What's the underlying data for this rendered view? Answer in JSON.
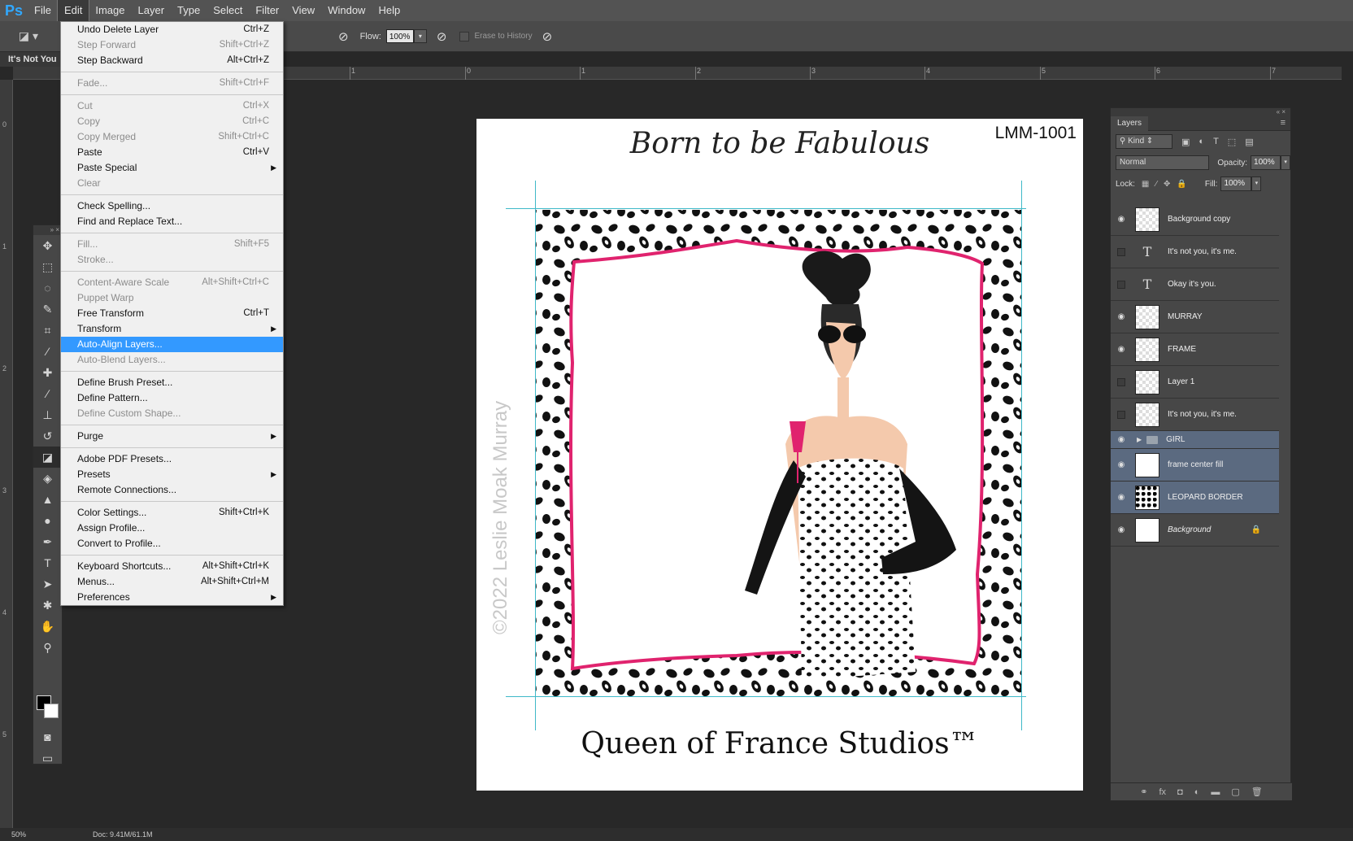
{
  "app": {
    "logo": "Ps"
  },
  "menubar": {
    "items": [
      "File",
      "Edit",
      "Image",
      "Layer",
      "Type",
      "Select",
      "Filter",
      "View",
      "Window",
      "Help"
    ],
    "active": "Edit"
  },
  "options": {
    "flow_label": "Flow:",
    "flow_value": "100%",
    "erase_history_label": "Erase to History"
  },
  "document": {
    "tab_title": "It's Not You",
    "code": "LMM-1001",
    "title": "Born to be Fabulous",
    "studio": "Queen of France Studios™",
    "watermark": "©2022 Leslie Moak Murray"
  },
  "ruler": {
    "top_ticks": [
      "1",
      "0",
      "1",
      "2",
      "3",
      "4",
      "5",
      "6",
      "7"
    ],
    "left_ticks": [
      "0",
      "1",
      "2",
      "3",
      "4",
      "5"
    ]
  },
  "edit_menu": [
    {
      "label": "Undo Delete Layer",
      "shortcut": "Ctrl+Z",
      "disabled": false
    },
    {
      "label": "Step Forward",
      "shortcut": "Shift+Ctrl+Z",
      "disabled": true
    },
    {
      "label": "Step Backward",
      "shortcut": "Alt+Ctrl+Z",
      "disabled": false
    },
    {
      "sep": true
    },
    {
      "label": "Fade...",
      "shortcut": "Shift+Ctrl+F",
      "disabled": true
    },
    {
      "sep": true
    },
    {
      "label": "Cut",
      "shortcut": "Ctrl+X",
      "disabled": true
    },
    {
      "label": "Copy",
      "shortcut": "Ctrl+C",
      "disabled": true
    },
    {
      "label": "Copy Merged",
      "shortcut": "Shift+Ctrl+C",
      "disabled": true
    },
    {
      "label": "Paste",
      "shortcut": "Ctrl+V",
      "disabled": false
    },
    {
      "label": "Paste Special",
      "shortcut": "",
      "disabled": false,
      "submenu": true
    },
    {
      "label": "Clear",
      "shortcut": "",
      "disabled": true
    },
    {
      "sep": true
    },
    {
      "label": "Check Spelling...",
      "shortcut": "",
      "disabled": false
    },
    {
      "label": "Find and Replace Text...",
      "shortcut": "",
      "disabled": false
    },
    {
      "sep": true
    },
    {
      "label": "Fill...",
      "shortcut": "Shift+F5",
      "disabled": true
    },
    {
      "label": "Stroke...",
      "shortcut": "",
      "disabled": true
    },
    {
      "sep": true
    },
    {
      "label": "Content-Aware Scale",
      "shortcut": "Alt+Shift+Ctrl+C",
      "disabled": true
    },
    {
      "label": "Puppet Warp",
      "shortcut": "",
      "disabled": true
    },
    {
      "label": "Free Transform",
      "shortcut": "Ctrl+T",
      "disabled": false
    },
    {
      "label": "Transform",
      "shortcut": "",
      "disabled": false,
      "submenu": true
    },
    {
      "label": "Auto-Align Layers...",
      "shortcut": "",
      "disabled": false,
      "highlighted": true
    },
    {
      "label": "Auto-Blend Layers...",
      "shortcut": "",
      "disabled": true
    },
    {
      "sep": true
    },
    {
      "label": "Define Brush Preset...",
      "shortcut": "",
      "disabled": false
    },
    {
      "label": "Define Pattern...",
      "shortcut": "",
      "disabled": false
    },
    {
      "label": "Define Custom Shape...",
      "shortcut": "",
      "disabled": true
    },
    {
      "sep": true
    },
    {
      "label": "Purge",
      "shortcut": "",
      "disabled": false,
      "submenu": true
    },
    {
      "sep": true
    },
    {
      "label": "Adobe PDF Presets...",
      "shortcut": "",
      "disabled": false
    },
    {
      "label": "Presets",
      "shortcut": "",
      "disabled": false,
      "submenu": true
    },
    {
      "label": "Remote Connections...",
      "shortcut": "",
      "disabled": false
    },
    {
      "sep": true
    },
    {
      "label": "Color Settings...",
      "shortcut": "Shift+Ctrl+K",
      "disabled": false
    },
    {
      "label": "Assign Profile...",
      "shortcut": "",
      "disabled": false
    },
    {
      "label": "Convert to Profile...",
      "shortcut": "",
      "disabled": false
    },
    {
      "sep": true
    },
    {
      "label": "Keyboard Shortcuts...",
      "shortcut": "Alt+Shift+Ctrl+K",
      "disabled": false
    },
    {
      "label": "Menus...",
      "shortcut": "Alt+Shift+Ctrl+M",
      "disabled": false
    },
    {
      "label": "Preferences",
      "shortcut": "",
      "disabled": false,
      "submenu": true
    }
  ],
  "layers_panel": {
    "tab": "Layers",
    "filter": "Kind",
    "blend_mode": "Normal",
    "opacity_label": "Opacity:",
    "opacity": "100%",
    "lock_label": "Lock:",
    "fill_label": "Fill:",
    "fill": "100%",
    "layers": [
      {
        "name": "Background copy",
        "visible": true,
        "thumb": "transparent",
        "selected": false
      },
      {
        "name": "It's not you,    it's me.",
        "visible": false,
        "thumb": "text",
        "selected": false
      },
      {
        "name": "Okay it's you.",
        "visible": false,
        "thumb": "text",
        "selected": false
      },
      {
        "name": "MURRAY",
        "visible": true,
        "thumb": "transparent",
        "selected": false
      },
      {
        "name": "FRAME",
        "visible": true,
        "thumb": "transparent",
        "selected": false
      },
      {
        "name": "Layer 1",
        "visible": false,
        "thumb": "transparent",
        "selected": false
      },
      {
        "name": "It's not you,    it's me.",
        "visible": false,
        "thumb": "transparent",
        "selected": false
      },
      {
        "name": "GIRL",
        "visible": true,
        "thumb": "folder",
        "selected": true
      },
      {
        "name": "frame center fill",
        "visible": true,
        "thumb": "white",
        "selected": true
      },
      {
        "name": "LEOPARD BORDER",
        "visible": true,
        "thumb": "leopard",
        "selected": true
      },
      {
        "name": "Background",
        "visible": true,
        "thumb": "white",
        "selected": false,
        "italic": true,
        "locked": true
      }
    ]
  },
  "status": {
    "zoom": "50%",
    "doc": "Doc: 9.41M/61.1M"
  },
  "colors": {
    "accent_pink": "#e0236e",
    "guide": "#3fb9c8",
    "highlight": "#3399ff"
  }
}
